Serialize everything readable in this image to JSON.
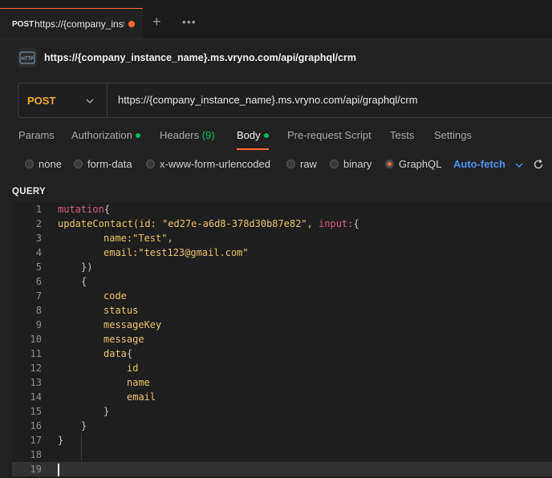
{
  "tab": {
    "method": "POST",
    "url": "https://{company_inst",
    "plus": "+",
    "more": "•••"
  },
  "request": {
    "title": "https://{company_instance_name}.ms.vryno.com/api/graphql/crm"
  },
  "urlbar": {
    "method": "POST",
    "url": "https://{company_instance_name}.ms.vryno.com/api/graphql/crm"
  },
  "subtabs": [
    {
      "label": "Params"
    },
    {
      "label": "Authorization",
      "indicator": true
    },
    {
      "label": "Headers",
      "count": "(9)"
    },
    {
      "label": "Body",
      "indicator": true,
      "active": true
    },
    {
      "label": "Pre-request Script"
    },
    {
      "label": "Tests"
    },
    {
      "label": "Settings"
    }
  ],
  "body_types": {
    "options": [
      "none",
      "form-data",
      "x-www-form-urlencoded",
      "raw",
      "binary",
      "GraphQL"
    ],
    "selected": "GraphQL",
    "auto_fetch": "Auto-fetch"
  },
  "query": {
    "label": "QUERY",
    "line_numbers": [
      "1",
      "2",
      "3",
      "4",
      "5",
      "6",
      "7",
      "8",
      "9",
      "10",
      "11",
      "12",
      "13",
      "14",
      "15",
      "16",
      "17",
      "18",
      "19"
    ],
    "lines": [
      [
        "mutation",
        "{"
      ],
      [
        "updateContact(id: \"ed27e-a6d8-378d30b87e82\", ",
        "input:",
        "{"
      ],
      [
        "name:\"Test\","
      ],
      [
        "email:\"test123@gmail.com\""
      ],
      [
        "})"
      ],
      [
        "{"
      ],
      [
        "code"
      ],
      [
        "status"
      ],
      [
        "messageKey"
      ],
      [
        "message"
      ],
      [
        "data",
        "{"
      ],
      [
        "id"
      ],
      [
        "name"
      ],
      [
        "email"
      ],
      [
        "}"
      ],
      [
        "}"
      ],
      [
        "}"
      ],
      [
        ""
      ],
      [
        ""
      ]
    ]
  },
  "colors": {
    "accent": "#ff6c37",
    "indicator": "#0cbb52",
    "method": "#f5a623",
    "link": "#4d90f0"
  }
}
